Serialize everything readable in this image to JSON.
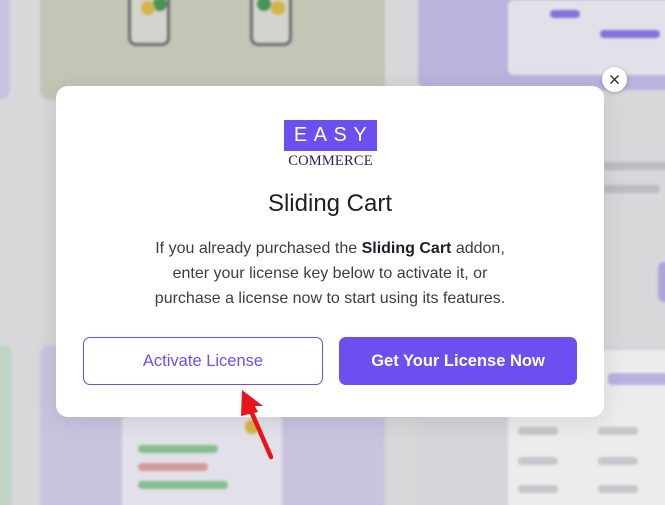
{
  "modal": {
    "logo_top": "EASY",
    "logo_bottom": "COMMERCE",
    "title": "Sliding Cart",
    "desc": {
      "line1_pre": "If you already purchased the ",
      "line1_bold": "Sliding Cart",
      "line1_post": " addon,",
      "line2": "enter your license key below to activate it, or",
      "line3": "purchase a license now to start using its features."
    },
    "activate_label": "Activate License",
    "get_label": "Get Your License Now",
    "close_icon": "close-icon"
  },
  "colors": {
    "brand": "#6d4ef0",
    "arrow": "#e8141b"
  }
}
